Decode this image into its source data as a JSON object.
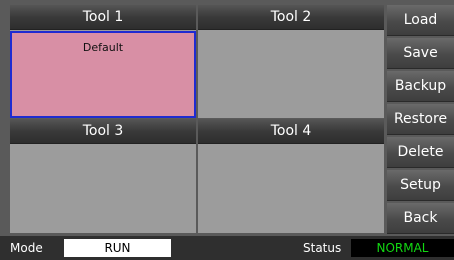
{
  "tools": [
    {
      "header": "Tool 1",
      "name": "Default",
      "selected": true
    },
    {
      "header": "Tool 2",
      "name": "",
      "selected": false
    },
    {
      "header": "Tool 3",
      "name": "",
      "selected": false
    },
    {
      "header": "Tool 4",
      "name": "",
      "selected": false
    }
  ],
  "side_buttons": {
    "load": "Load",
    "save": "Save",
    "backup": "Backup",
    "restore": "Restore",
    "delete": "Delete",
    "setup": "Setup",
    "back": "Back"
  },
  "status_bar": {
    "mode_label": "Mode",
    "mode_value": "RUN",
    "status_label": "Status",
    "status_value": "NORMAL"
  },
  "colors": {
    "selected_tool_fill": "#d88fa5",
    "selected_tool_border": "#1f2bd1",
    "status_ok": "#12d812"
  }
}
